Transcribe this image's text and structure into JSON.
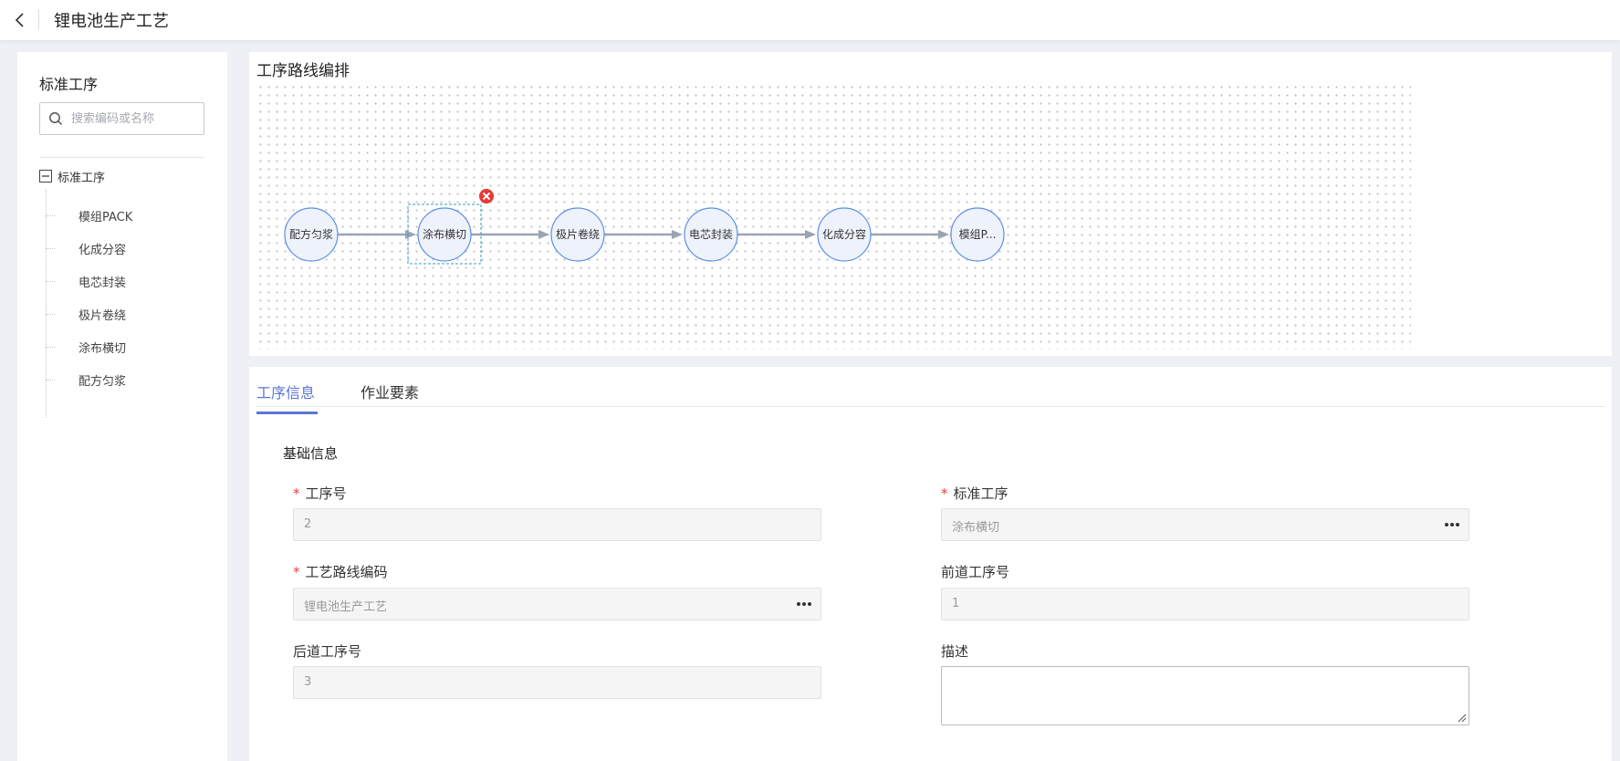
{
  "header": {
    "title": "锂电池生产工艺"
  },
  "sidebar": {
    "title": "标准工序",
    "search_placeholder": "搜索编码或名称",
    "tree_root": "标准工序",
    "items": [
      {
        "label": "模组PACK"
      },
      {
        "label": "化成分容"
      },
      {
        "label": "电芯封装"
      },
      {
        "label": "极片卷绕"
      },
      {
        "label": "涂布横切"
      },
      {
        "label": "配方匀浆"
      }
    ]
  },
  "route": {
    "title": "工序路线编排",
    "nodes": [
      {
        "label": "配方匀浆",
        "selected": false
      },
      {
        "label": "涂布横切",
        "selected": true
      },
      {
        "label": "极片卷绕",
        "selected": false
      },
      {
        "label": "电芯封装",
        "selected": false
      },
      {
        "label": "化成分容",
        "selected": false
      },
      {
        "label": "模组P...",
        "selected": false
      }
    ],
    "colors": {
      "node_fill": "#eef2fb",
      "node_stroke": "#5b8ee6",
      "edge": "#99a3b3",
      "selection": "#2f9ec7",
      "delete_badge": "#e53935"
    }
  },
  "tabs": [
    {
      "label": "工序信息",
      "active": true
    },
    {
      "label": "作业要素",
      "active": false
    }
  ],
  "form": {
    "section_title": "基础信息",
    "process_no": {
      "label": "工序号",
      "value": "2"
    },
    "standard_process": {
      "label": "标准工序",
      "value": "涂布横切"
    },
    "route_code": {
      "label": "工艺路线编码",
      "value": "锂电池生产工艺"
    },
    "prev_process_no": {
      "label": "前道工序号",
      "value": "1"
    },
    "next_process_no": {
      "label": "后道工序号",
      "value": "3"
    },
    "description": {
      "label": "描述",
      "value": ""
    }
  },
  "colors": {
    "accent": "#5b76d6",
    "required": "#e33e3e"
  }
}
